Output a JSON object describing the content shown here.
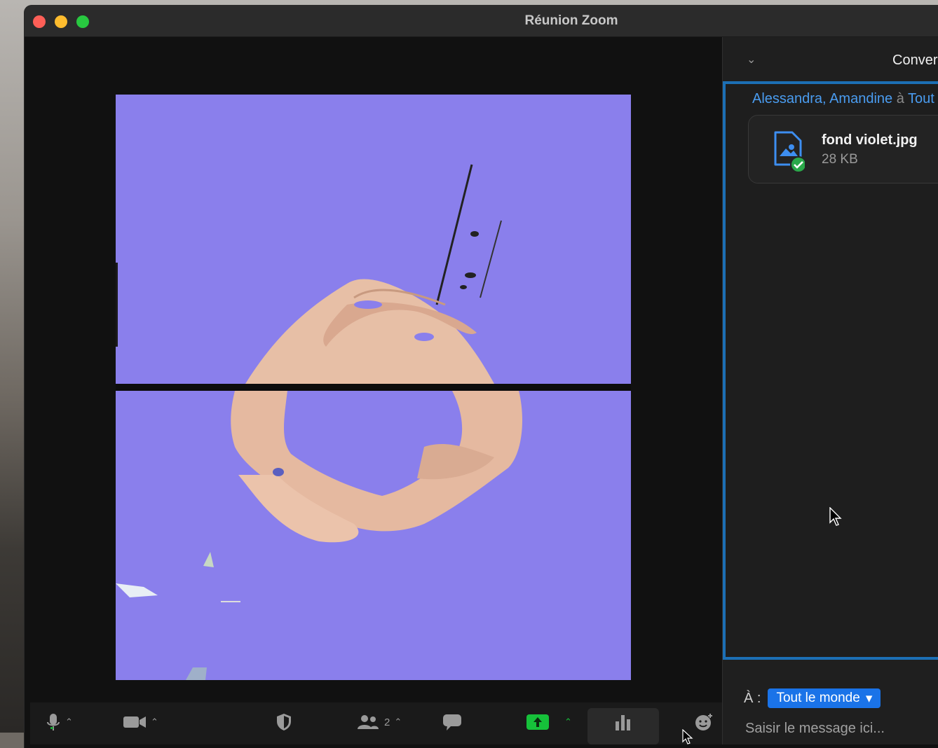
{
  "window": {
    "title": "Réunion Zoom"
  },
  "toolbar": {
    "participants_count": "2",
    "items": [
      "microphone-icon",
      "video-camera-icon",
      "security-shield-icon",
      "participants-icon",
      "chat-bubble-icon",
      "share-screen-icon",
      "polls-icon",
      "reactions-icon"
    ]
  },
  "chat": {
    "panel_title": "Conver",
    "sender_names": "Alessandra, Amandine",
    "sender_joiner": "à",
    "sender_target": "Tout",
    "file": {
      "name": "fond violet.jpg",
      "size": "28 KB"
    },
    "to_label": "À :",
    "recipient": "Tout le monde",
    "placeholder": "Saisir le message ici..."
  },
  "colors": {
    "video_bg": "#8a7fec",
    "accent": "#1a73e8",
    "share_green": "#16c13a",
    "chat_border": "#1c6fb5"
  }
}
